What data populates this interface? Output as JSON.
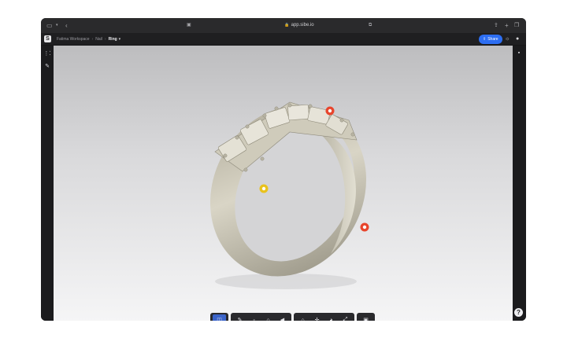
{
  "browser": {
    "url": "app.sibe.io",
    "icons": [
      "sidebar-toggle-icon",
      "chevron-down-icon",
      "back-icon",
      "privacy-icon",
      "translate-icon",
      "share-icon",
      "new-tab-icon",
      "tabs-icon"
    ]
  },
  "header": {
    "logo_glyph": "S",
    "breadcrumbs": [
      "Fatima Workspace",
      "Nail",
      "Ring"
    ],
    "current_caret": "⌄",
    "share_label": "Share"
  },
  "toolbar": {
    "groups": [
      [
        "view-mode-icon"
      ],
      [
        "measure-icon",
        "point-icon",
        "section-icon",
        "sound-icon"
      ],
      [
        "home-icon",
        "move-icon",
        "explode-icon",
        "axis-icon"
      ],
      [
        "camera-icon"
      ]
    ],
    "active": "view-mode-icon"
  },
  "annotations": {
    "pins": [
      {
        "color": "#e8452c"
      },
      {
        "color": "#e8452c"
      },
      {
        "color": "#e9c21c"
      }
    ]
  },
  "help_label": "?"
}
